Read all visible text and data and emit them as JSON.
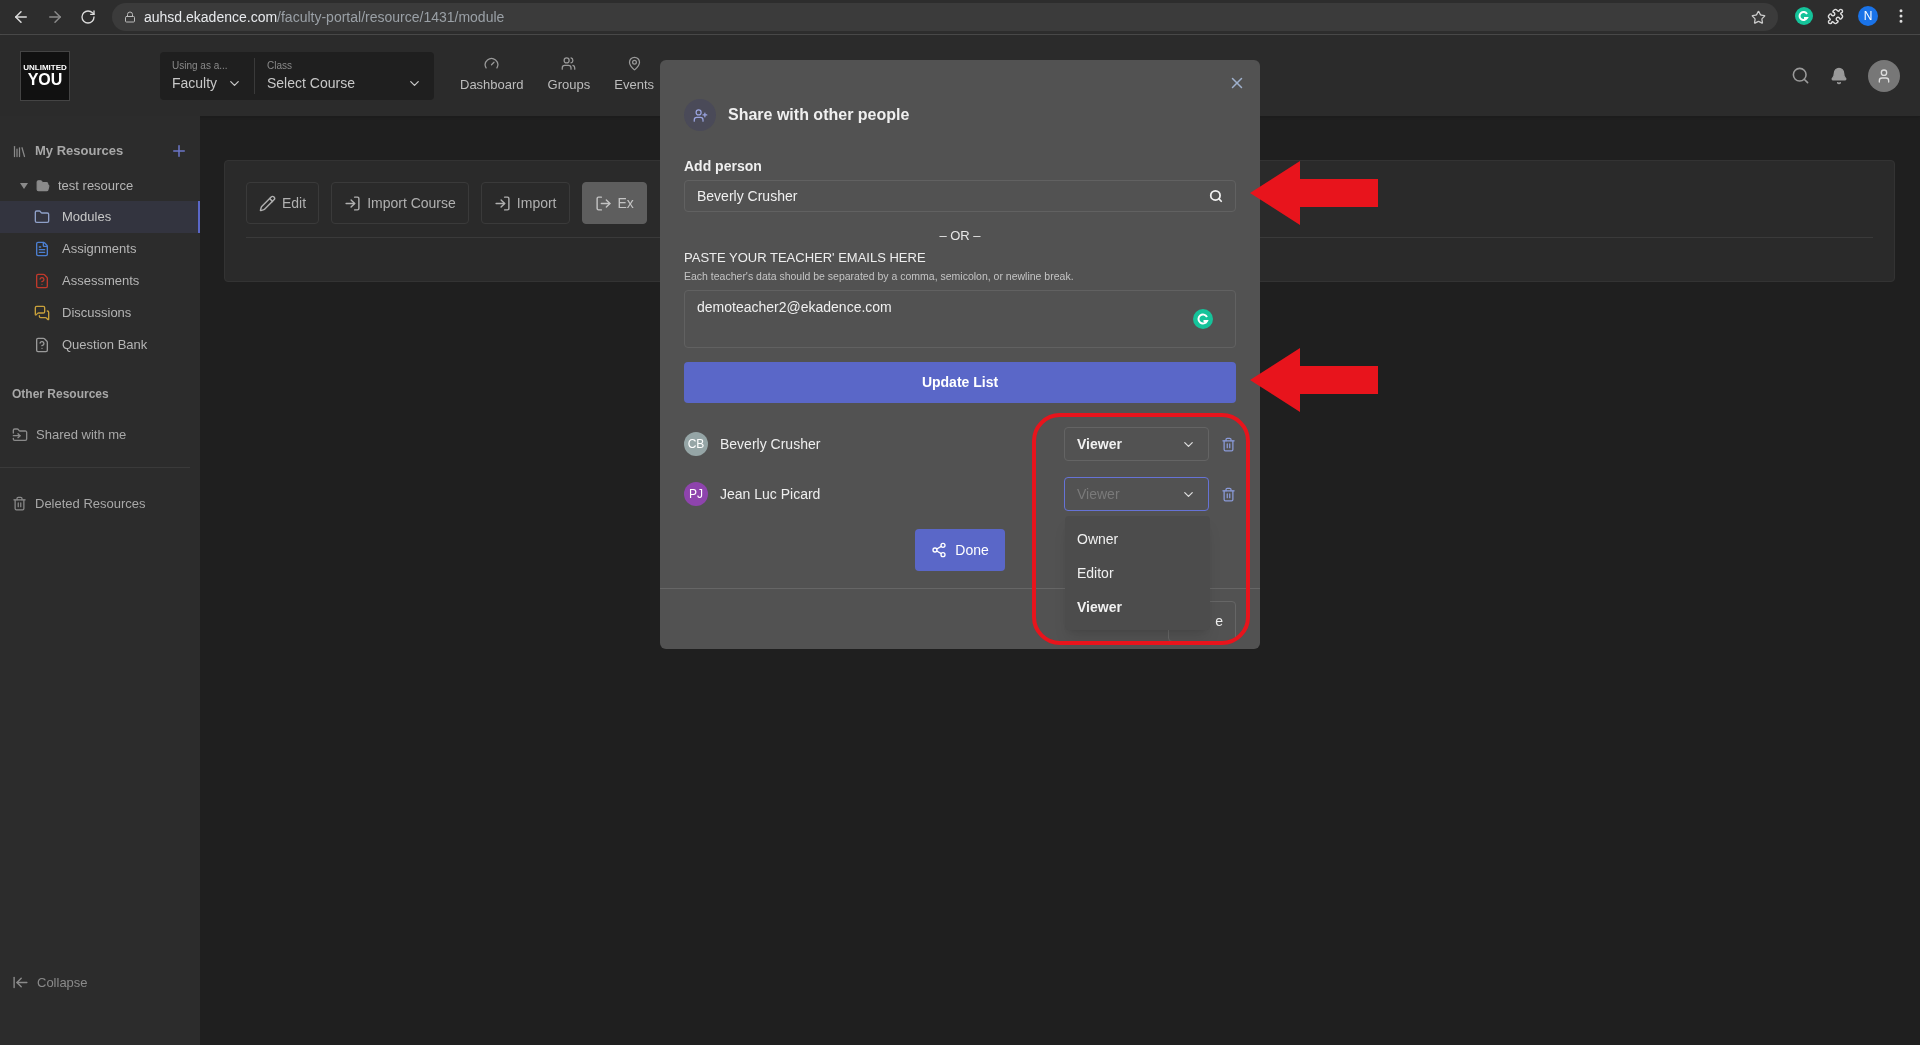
{
  "browser": {
    "url_host": "auhsd.ekadence.com",
    "url_path": "/faculty-portal/resource/1431/module",
    "profile": "N"
  },
  "header": {
    "logo": [
      "UNLIMITED",
      "YOU"
    ],
    "role_select": {
      "label": "Using as a...",
      "value": "Faculty"
    },
    "class_select": {
      "label": "Class",
      "value": "Select Course"
    },
    "nav": [
      {
        "label": "Dashboard"
      },
      {
        "label": "Groups"
      },
      {
        "label": "Events"
      }
    ]
  },
  "sidebar": {
    "my_resources": "My Resources",
    "tree": [
      {
        "label": "test resource",
        "expanded": true,
        "children": [
          {
            "label": "Modules",
            "selected": true
          },
          {
            "label": "Assignments",
            "selected": false
          },
          {
            "label": "Assessments",
            "selected": false
          },
          {
            "label": "Discussions",
            "selected": false
          },
          {
            "label": "Question Bank",
            "selected": false
          }
        ]
      }
    ],
    "other_heading": "Other Resources",
    "other_items": [
      "Shared with me"
    ],
    "deleted": "Deleted Resources",
    "collapse": "Collapse"
  },
  "toolbar": [
    {
      "label": "Edit",
      "disabled": false
    },
    {
      "label": "Import Course",
      "disabled": false
    },
    {
      "label": "Import",
      "disabled": false
    },
    {
      "label": "Ex",
      "disabled": true
    }
  ],
  "modal": {
    "title": "Share with other people",
    "add_person": {
      "label": "Add person",
      "value": "Beverly Crusher"
    },
    "or_text": "– OR –",
    "paste_heading": "PASTE YOUR TEACHER' EMAILS HERE",
    "paste_help": "Each teacher's data should be separated by a comma, semicolon, or newline break.",
    "emails_value": "demoteacher2@ekadence.com",
    "update_button": "Update List",
    "people": [
      {
        "initials": "CB",
        "name": "Beverly Crusher",
        "color": "#95a5a6",
        "role": "Viewer",
        "focused": false
      },
      {
        "initials": "PJ",
        "name": "Jean Luc Picard",
        "color": "#8e44ad",
        "role": "Viewer",
        "focused": true
      }
    ],
    "role_menu": [
      {
        "label": "Owner",
        "selected": false
      },
      {
        "label": "Editor",
        "selected": false
      },
      {
        "label": "Viewer",
        "selected": true
      }
    ],
    "done_button": "Done",
    "close_button": "e"
  }
}
